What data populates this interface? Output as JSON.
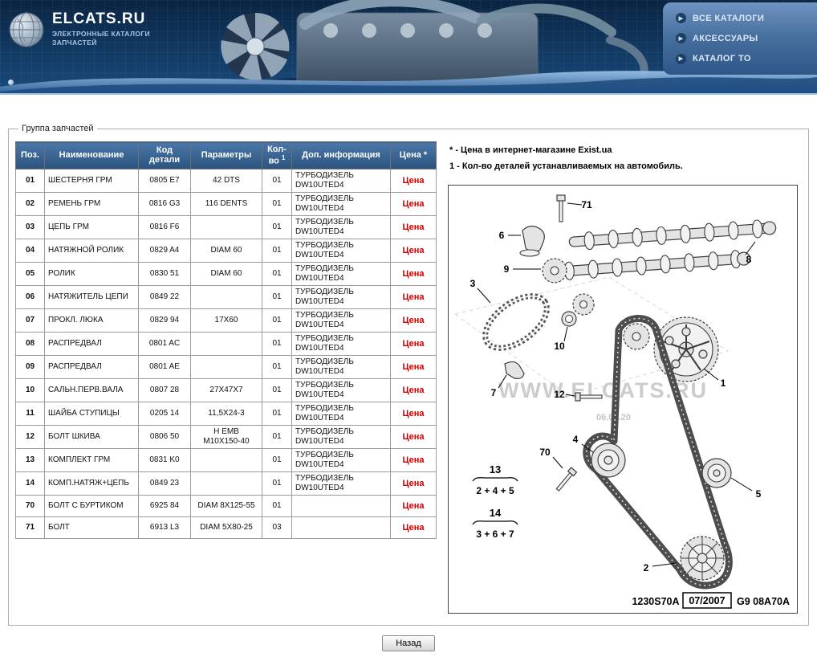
{
  "header": {
    "logo_title": "ELCATS.RU",
    "logo_subtitle_line1": "ЭЛЕКТРОННЫЕ КАТАЛОГИ",
    "logo_subtitle_line2": "ЗАПЧАСТЕЙ",
    "nav_items": [
      {
        "label": "ВСЕ КАТАЛОГИ"
      },
      {
        "label": "АКСЕССУАРЫ"
      },
      {
        "label": "КАТАЛОГ ТО"
      }
    ]
  },
  "section_legend": "Группа запчастей",
  "table": {
    "h_pos": "Поз.",
    "h_name": "Наименование",
    "h_code": "Код детали",
    "h_params": "Параметры",
    "h_qty": "Кол-во",
    "h_qty_sup": "1",
    "h_info": "Доп. информация",
    "h_price": "Цена *",
    "price_label": "Цена",
    "rows": [
      {
        "pos": "01",
        "name": "ШЕСТЕРНЯ ГРМ",
        "code": "0805 E7",
        "params": "42 DTS",
        "qty": "01",
        "info": "ТУРБОДИЗЕЛЬ DW10UTED4"
      },
      {
        "pos": "02",
        "name": "РЕМЕНЬ ГРМ",
        "code": "0816 G3",
        "params": "116 DENTS",
        "qty": "01",
        "info": "ТУРБОДИЗЕЛЬ DW10UTED4"
      },
      {
        "pos": "03",
        "name": "ЦЕПЬ ГРМ",
        "code": "0816 F6",
        "params": "",
        "qty": "01",
        "info": "ТУРБОДИЗЕЛЬ DW10UTED4"
      },
      {
        "pos": "04",
        "name": "НАТЯЖНОЙ РОЛИК",
        "code": "0829 A4",
        "params": "DIAM 60",
        "qty": "01",
        "info": "ТУРБОДИЗЕЛЬ DW10UTED4"
      },
      {
        "pos": "05",
        "name": "РОЛИК",
        "code": "0830 51",
        "params": "DIAM 60",
        "qty": "01",
        "info": "ТУРБОДИЗЕЛЬ DW10UTED4"
      },
      {
        "pos": "06",
        "name": "НАТЯЖИТЕЛЬ ЦЕПИ",
        "code": "0849 22",
        "params": "",
        "qty": "01",
        "info": "ТУРБОДИЗЕЛЬ DW10UTED4"
      },
      {
        "pos": "07",
        "name": "ПРОКЛ. ЛЮКА",
        "code": "0829 94",
        "params": "17X60",
        "qty": "01",
        "info": "ТУРБОДИЗЕЛЬ DW10UTED4"
      },
      {
        "pos": "08",
        "name": "РАСПРЕДВАЛ",
        "code": "0801 AC",
        "params": "",
        "qty": "01",
        "info": "ТУРБОДИЗЕЛЬ DW10UTED4"
      },
      {
        "pos": "09",
        "name": "РАСПРЕДВАЛ",
        "code": "0801 AE",
        "params": "",
        "qty": "01",
        "info": "ТУРБОДИЗЕЛЬ DW10UTED4"
      },
      {
        "pos": "10",
        "name": "САЛЬН.ПЕРВ.ВАЛА",
        "code": "0807 28",
        "params": "27X47X7",
        "qty": "01",
        "info": "ТУРБОДИЗЕЛЬ DW10UTED4"
      },
      {
        "pos": "11",
        "name": "ШАЙБА СТУПИЦЫ",
        "code": "0205 14",
        "params": "11,5X24-3",
        "qty": "01",
        "info": "ТУРБОДИЗЕЛЬ DW10UTED4"
      },
      {
        "pos": "12",
        "name": "БОЛТ ШКИВА",
        "code": "0806 50",
        "params": "H EMB M10X150-40",
        "qty": "01",
        "info": "ТУРБОДИЗЕЛЬ DW10UTED4"
      },
      {
        "pos": "13",
        "name": "КОМПЛЕКТ ГРМ",
        "code": "0831 K0",
        "params": "",
        "qty": "01",
        "info": "ТУРБОДИЗЕЛЬ DW10UTED4"
      },
      {
        "pos": "14",
        "name": "КОМП.НАТЯЖ+ЦЕПЬ",
        "code": "0849 23",
        "params": "",
        "qty": "01",
        "info": "ТУРБОДИЗЕЛЬ DW10UTED4"
      },
      {
        "pos": "70",
        "name": "БОЛТ С БУРТИКОМ",
        "code": "6925 84",
        "params": "DIAM 8X125-55",
        "qty": "01",
        "info": ""
      },
      {
        "pos": "71",
        "name": "БОЛТ",
        "code": "6913 L3",
        "params": "DIAM 5X80-25",
        "qty": "03",
        "info": ""
      }
    ]
  },
  "notes": {
    "note_price": "* - Цена в интернет-магазине Exist.ua",
    "note_qty": "1 - Кол-во деталей устанавливаемых на автомобиль."
  },
  "diagram": {
    "labels": [
      "71",
      "6",
      "8",
      "9",
      "3",
      "10",
      "1",
      "12",
      "7",
      "4",
      "70",
      "5",
      "2"
    ],
    "kits": [
      {
        "num": "13",
        "expr": "2 + 4 + 5"
      },
      {
        "num": "14",
        "expr": "3 + 6 + 7"
      }
    ],
    "watermark": "WWW.ELCATS.RU",
    "watermark_date": "06.06.20",
    "plate_code": "1230S70A",
    "plate_date": "07/2007",
    "plate_ref": "G9 08A70A"
  },
  "back_button_label": "Назад"
}
